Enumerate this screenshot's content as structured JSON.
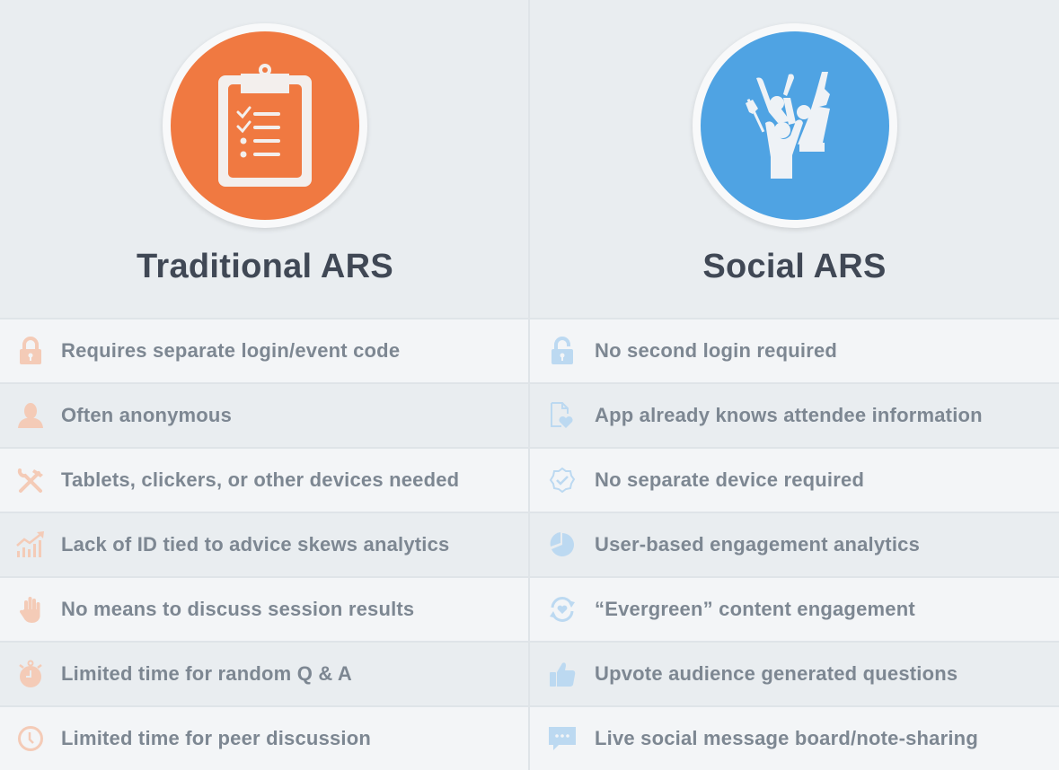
{
  "colors": {
    "traditional_accent": "#f07941",
    "social_accent": "#4fa3e3",
    "traditional_icon_tint": "#f4cbb7",
    "social_icon_tint": "#bcd9f1",
    "title_text": "#404855",
    "row_text": "#7d8792"
  },
  "columns": [
    {
      "title": "Traditional ARS",
      "header_icon": "clipboard-checklist-icon",
      "rows": [
        {
          "icon": "lock-icon",
          "text": "Requires separate login/event code"
        },
        {
          "icon": "user-icon",
          "text": "Often anonymous"
        },
        {
          "icon": "tools-icon",
          "text": "Tablets, clickers, or other devices needed"
        },
        {
          "icon": "growth-chart-icon",
          "text": "Lack of ID tied to advice skews analytics"
        },
        {
          "icon": "raised-hand-icon",
          "text": "No means to discuss session results"
        },
        {
          "icon": "stopwatch-icon",
          "text": "Limited time for random Q & A"
        },
        {
          "icon": "clock-icon",
          "text": "Limited time for peer discussion"
        }
      ]
    },
    {
      "title": "Social ARS",
      "header_icon": "cheering-crowd-icon",
      "rows": [
        {
          "icon": "unlock-icon",
          "text": "No second login required"
        },
        {
          "icon": "document-heart-icon",
          "text": "App already knows attendee information"
        },
        {
          "icon": "verified-badge-icon",
          "text": "No separate device required"
        },
        {
          "icon": "pie-chart-icon",
          "text": "User-based engagement analytics"
        },
        {
          "icon": "refresh-heart-icon",
          "text": "“Evergreen” content engagement"
        },
        {
          "icon": "thumbs-up-icon",
          "text": "Upvote audience generated questions"
        },
        {
          "icon": "chat-bubble-icon",
          "text": "Live social message board/note-sharing"
        }
      ]
    }
  ]
}
